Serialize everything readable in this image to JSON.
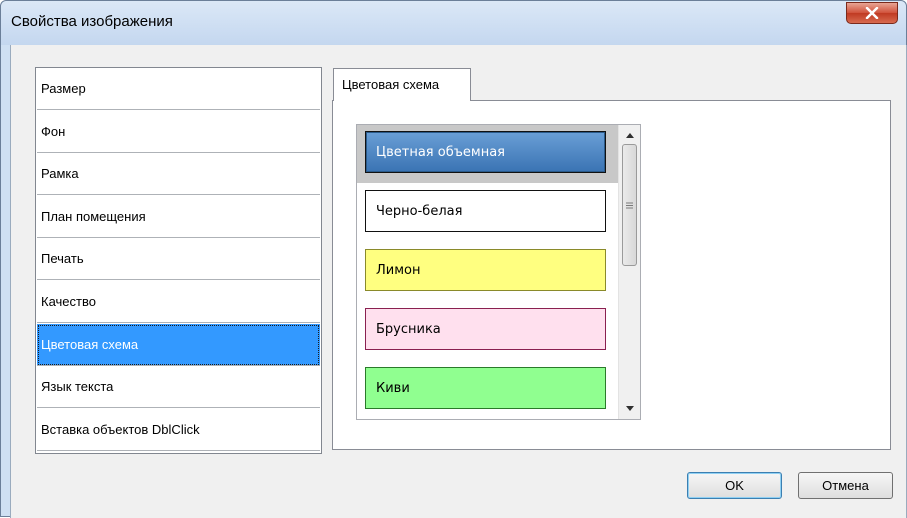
{
  "window": {
    "title": "Свойства изображения"
  },
  "nav": {
    "items": [
      {
        "label": "Размер"
      },
      {
        "label": "Фон"
      },
      {
        "label": "Рамка"
      },
      {
        "label": "План помещения"
      },
      {
        "label": "Печать"
      },
      {
        "label": "Качество"
      },
      {
        "label": "Цветовая схема",
        "selected": true
      },
      {
        "label": "Язык текста"
      },
      {
        "label": "Вставка объектов DblClick"
      }
    ]
  },
  "tab": {
    "label": "Цветовая схема"
  },
  "schemes": {
    "items": [
      {
        "label": "Цветная объемная",
        "selected": true,
        "bg": "#4a83c0",
        "fg": "#ffffff",
        "border": "#111111"
      },
      {
        "label": "Черно-белая",
        "bg": "#ffffff",
        "fg": "#000000",
        "border": "#111111"
      },
      {
        "label": "Лимон",
        "bg": "#ffff80",
        "fg": "#000000",
        "border": "#8a8a2a"
      },
      {
        "label": "Брусника",
        "bg": "#ffe0ee",
        "fg": "#000000",
        "border": "#8a2050"
      },
      {
        "label": "Киви",
        "bg": "#90ff90",
        "fg": "#000000",
        "border": "#2a7a2a"
      }
    ]
  },
  "buttons": {
    "ok": "OK",
    "cancel": "Отмена"
  },
  "colors": {
    "selection": "#3399ff",
    "close_button": "#c8452c"
  }
}
